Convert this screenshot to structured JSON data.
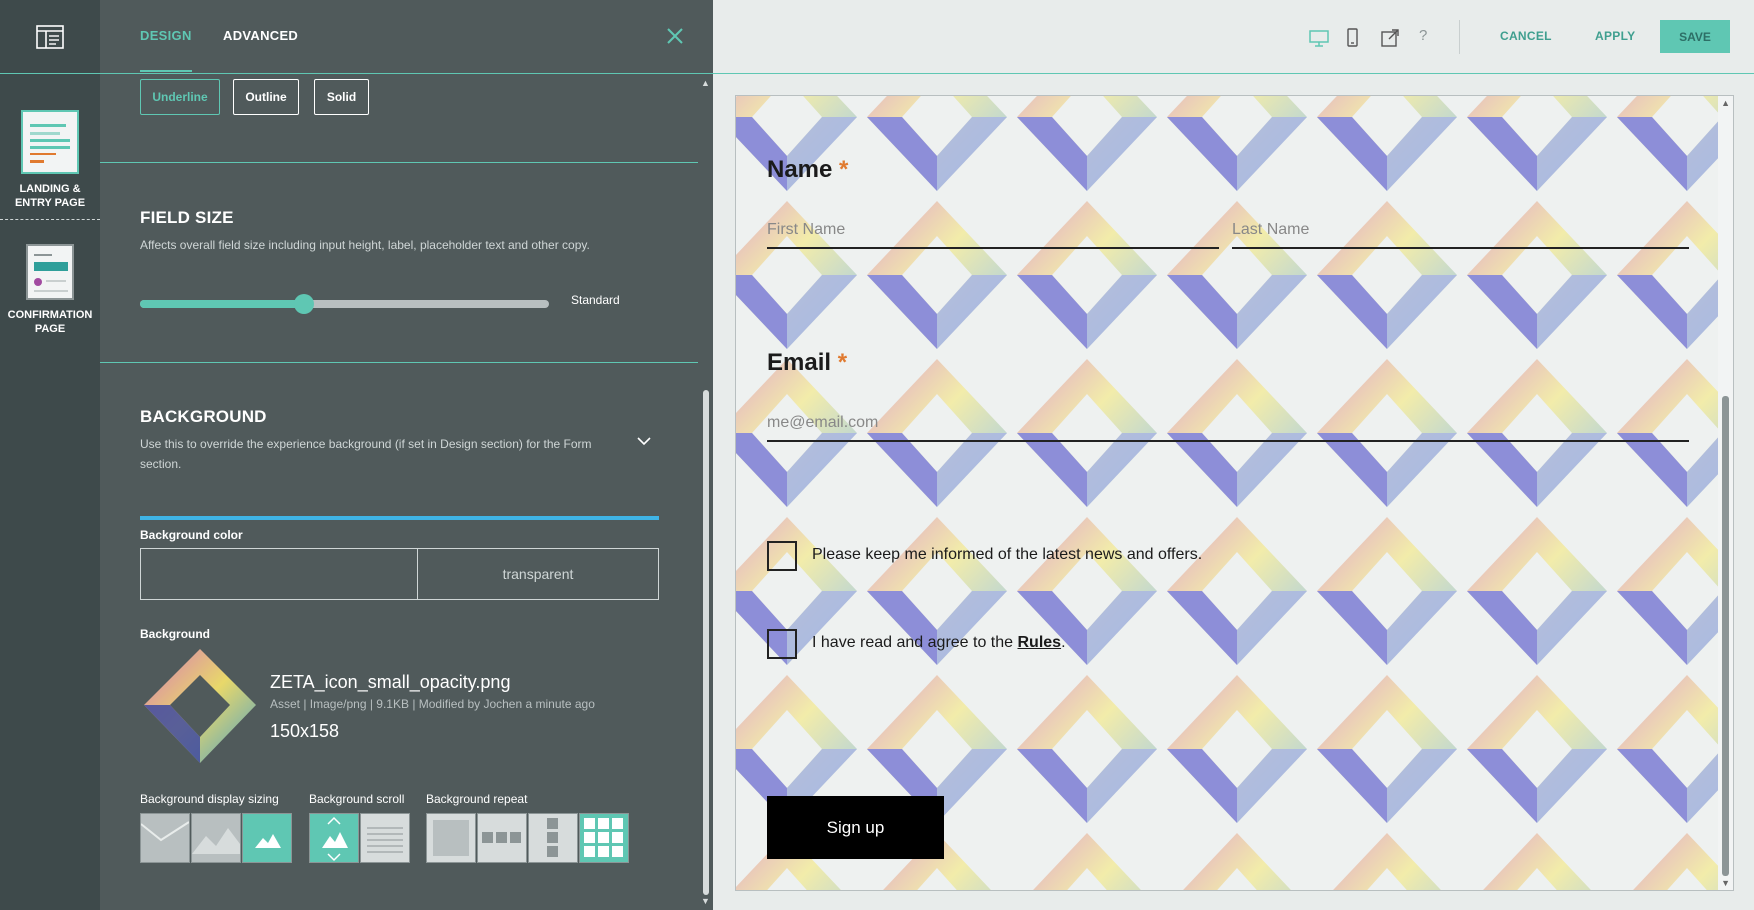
{
  "rail": {
    "items": [
      {
        "label_line1": "LANDING &",
        "label_line2": "ENTRY PAGE"
      },
      {
        "label_line1": "CONFIRMATION",
        "label_line2": "PAGE"
      }
    ]
  },
  "panel": {
    "tabs": [
      "DESIGN",
      "ADVANCED"
    ],
    "style_buttons": [
      "Underline",
      "Outline",
      "Solid"
    ],
    "field_size": {
      "title": "FIELD SIZE",
      "description": "Affects overall field size including input height, label, placeholder text and other copy.",
      "value_label": "Standard",
      "level": 0.4
    },
    "background": {
      "title": "BACKGROUND",
      "description_line1": "Use this to override the experience background (if set in Design section) for the Form",
      "description_line2": "section.",
      "color_label": "Background color",
      "color_value": "transparent",
      "image_label": "Background",
      "asset_name": "ZETA_icon_small_opacity.png",
      "asset_meta": "Asset | Image/png | 9.1KB | Modified by Jochen a minute ago",
      "asset_dims": "150x158",
      "sizing_label": "Background display sizing",
      "scroll_label": "Background scroll",
      "repeat_label": "Background repeat"
    }
  },
  "toolbar": {
    "cancel": "CANCEL",
    "apply": "APPLY",
    "save": "SAVE",
    "help": "?"
  },
  "form": {
    "name_label": "Name",
    "required_mark": "*",
    "first_name_placeholder": "First Name",
    "last_name_placeholder": "Last Name",
    "email_label": "Email",
    "email_placeholder": "me@email.com",
    "news_checkbox_text": "Please keep me informed of the latest news and offers.",
    "rules_prefix": "I have read and agree to the ",
    "rules_link": "Rules",
    "rules_suffix": ".",
    "submit": "Sign up"
  },
  "colors": {
    "accent": "#5fc7b3",
    "panel_bg": "#505a5b",
    "rail_bg": "#3e4a4b",
    "required": "#e07a2f",
    "progress_bar": "#3fb4e6"
  }
}
